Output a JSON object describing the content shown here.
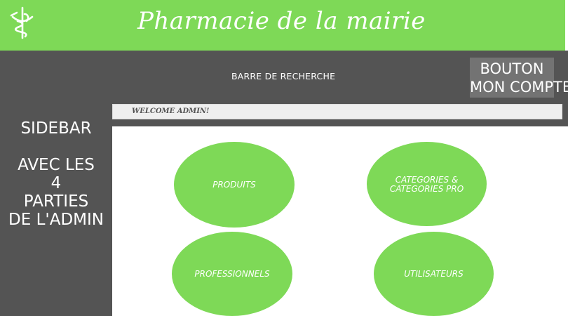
{
  "header": {
    "title": "Pharmacie de la mairie",
    "logo_icon": "caduceus-icon",
    "brand_color": "#7ed957"
  },
  "topbar": {
    "search_label": "BARRE DE RECHERCHE",
    "account_button": [
      "BOUTON",
      "MON COMPTE"
    ],
    "background": "#545454"
  },
  "sidebar": {
    "title": "SIDEBAR",
    "description": [
      "AVEC LES",
      "4",
      "PARTIES",
      "DE L'ADMIN"
    ]
  },
  "main": {
    "welcome": "WELCOME ADMIN!",
    "tiles": [
      {
        "label": [
          "PRODUITS"
        ]
      },
      {
        "label": [
          "CATEGORIES &",
          "CATEGORIES PRO"
        ]
      },
      {
        "label": [
          "PROFESSIONNELS"
        ]
      },
      {
        "label": [
          "UTILISATEURS"
        ]
      }
    ]
  }
}
